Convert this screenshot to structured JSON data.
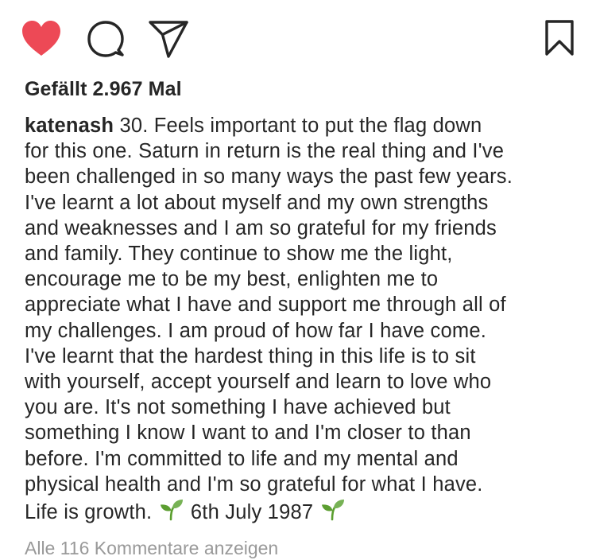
{
  "actions": {
    "like_icon": "heart-filled-icon",
    "comment_icon": "speech-bubble-icon",
    "share_icon": "paper-plane-icon",
    "save_icon": "bookmark-icon",
    "like_color": "#ed4956"
  },
  "likes": {
    "text": "Gefällt 2.967 Mal"
  },
  "caption": {
    "username": "katenash",
    "lines": [
      " 30. Feels important to put the flag down",
      "for this one. Saturn in return is the real thing and I've",
      "been challenged in so many ways the past few years.",
      "I've learnt a lot about myself and my own strengths",
      "and weaknesses and I am so grateful for my friends",
      "and family. They continue to show me the light,",
      "encourage me to be my best, enlighten me to",
      "appreciate what I have and support me through all of",
      "my challenges. I am proud of how far I have come.",
      "I've learnt that the hardest thing in this life is to sit",
      "with yourself, accept yourself and learn to love who",
      "you are. It's not something I have achieved but",
      "something I know I want to and I'm closer to than",
      "before. I'm committed to life and my mental and",
      "physical health and I'm so grateful for what I have."
    ],
    "last_line_start": "Life is growth.",
    "last_line_date": "6th July 1987",
    "emoji_icon": "seedling-emoji-icon"
  },
  "comments": {
    "view_all": "Alle 116 Kommentare anzeigen"
  }
}
